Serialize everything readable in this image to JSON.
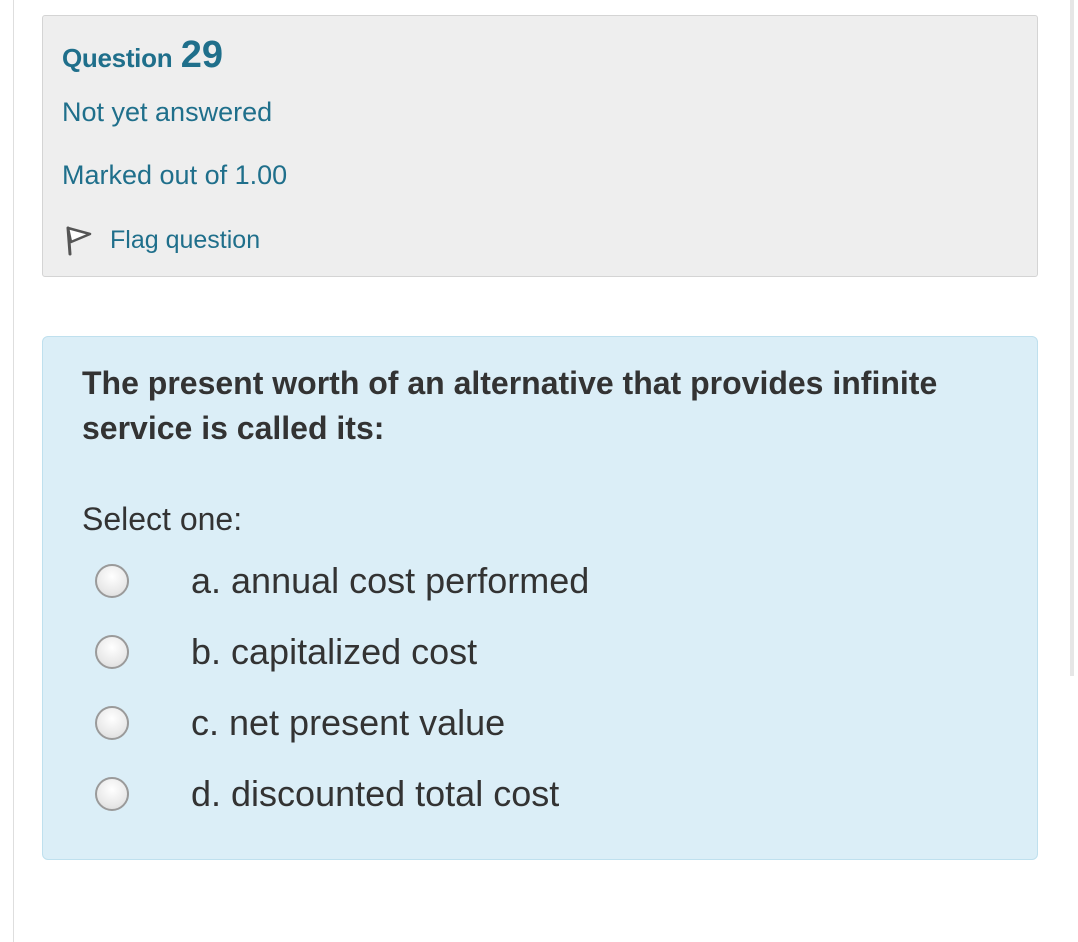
{
  "question_info": {
    "label": "Question",
    "number": "29",
    "state": "Not yet answered",
    "grade": "Marked out of 1.00",
    "flag_label": "Flag question",
    "flag_icon": "flag-icon"
  },
  "question": {
    "text": "The present worth of an alternative that provides infinite service is called its:",
    "prompt": "Select one:",
    "options": [
      {
        "label": "a. annual cost performed",
        "selected": false
      },
      {
        "label": "b. capitalized cost",
        "selected": false
      },
      {
        "label": "c. net present value",
        "selected": false
      },
      {
        "label": "d. discounted total cost",
        "selected": false
      }
    ]
  },
  "colors": {
    "accent": "#1f6f8b",
    "info_bg": "#eeeeee",
    "formulation_bg": "#dbeef7",
    "text": "#333333"
  }
}
